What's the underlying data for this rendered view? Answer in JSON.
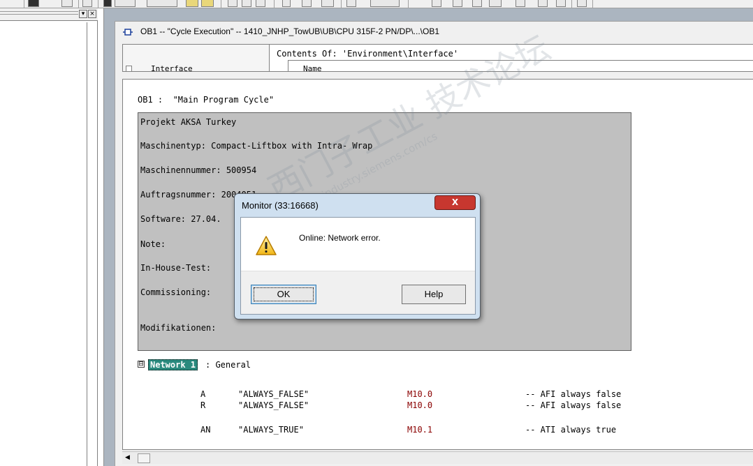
{
  "window": {
    "title": "OB1 -- \"Cycle Execution\" -- 1410_JNHP_TowUB\\UB\\CPU 315F-2 PN/DP\\...\\OB1"
  },
  "interface_pane": {
    "contents_header": "Contents Of: 'Environment\\Interface'",
    "tree_root": "Interface",
    "name_column": "Name"
  },
  "block": {
    "title": "OB1 :  \"Main Program Cycle\"",
    "comment_lines": [
      "Projekt AKSA Turkey",
      "Maschinentyp: Compact-Liftbox with Intra- Wrap",
      "Maschinennummer: 500954",
      "Auftragsnummer: 2004051",
      "Software: 27.04.",
      "Note:",
      "In-House-Test:",
      "Commissioning:",
      "Modifikationen:"
    ]
  },
  "network": {
    "label": "Network 1",
    "title": ": General",
    "collapse_glyph": "⊟",
    "statements": [
      {
        "op": "A",
        "symbol": "\"ALWAYS_FALSE\"",
        "address": "M10.0",
        "comment": "-- AFI always false"
      },
      {
        "op": "R",
        "symbol": "\"ALWAYS_FALSE\"",
        "address": "M10.0",
        "comment": "-- AFI always false"
      },
      {
        "op": "AN",
        "symbol": "\"ALWAYS_TRUE\"",
        "address": "M10.1",
        "comment": "-- ATI always true"
      }
    ]
  },
  "dialog": {
    "title": "Monitor (33:16668)",
    "message": "Online: Network error.",
    "close_glyph": "X",
    "ok_label": "OK",
    "help_label": "Help",
    "icon": "warning-icon"
  },
  "watermark": {
    "chinese": "西门子工业 技术论坛",
    "url": "support.industry.siemens.com/cs"
  },
  "colors": {
    "network_label_bg": "#2a8a7e",
    "address_color": "#8a0000",
    "comment_box_bg": "#c0c0c0",
    "close_button": "#c7372f"
  }
}
